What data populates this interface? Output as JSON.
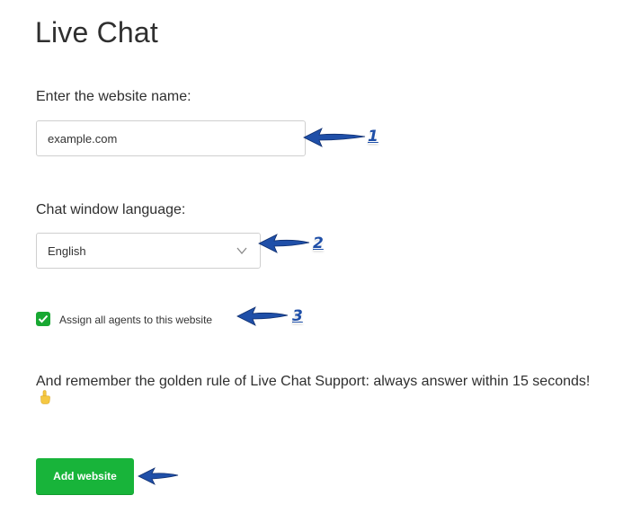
{
  "page": {
    "title": "Live Chat"
  },
  "form": {
    "website_label": "Enter the website name:",
    "website_value": "example.com",
    "language_label": "Chat window language:",
    "language_selected": "English",
    "assign_agents_label": "Assign all agents to this website",
    "assign_agents_checked": true,
    "rule_text": "And remember the golden rule of Live Chat Support: always answer within 15 seconds!",
    "submit_label": "Add website"
  },
  "annotations": {
    "callouts": [
      "1",
      "2",
      "3"
    ]
  },
  "colors": {
    "accent_green": "#18b43a",
    "annotation_blue": "#1f4fa8"
  },
  "icons": {
    "chevron": "chevron-down-icon",
    "check": "checkmark-icon",
    "hand": "pointing-hand-icon",
    "arrow": "left-arrow-icon"
  }
}
